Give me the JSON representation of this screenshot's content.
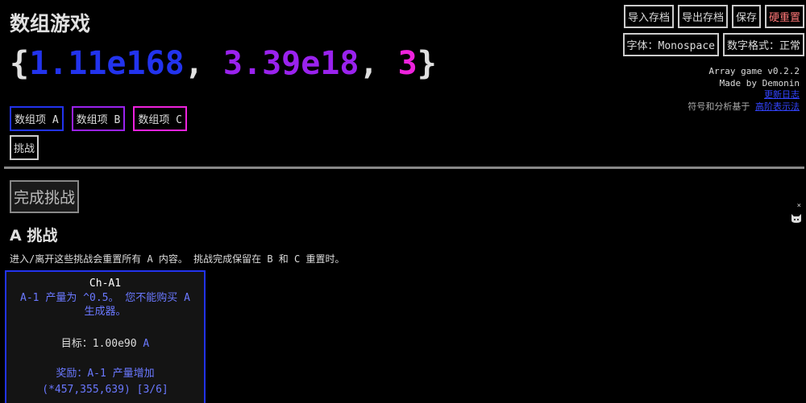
{
  "app": {
    "title": "数组游戏"
  },
  "array": {
    "open": "{",
    "a": "1.11e168",
    "sep1": ", ",
    "b": "3.39e18",
    "sep2": ", ",
    "c": "3",
    "close": "}"
  },
  "tabs": [
    {
      "label": "数组项 A"
    },
    {
      "label": "数组项 B"
    },
    {
      "label": "数组项 C"
    }
  ],
  "challenge_tab": {
    "label": "挑战"
  },
  "header_buttons": {
    "import": "导入存档",
    "export": "导出存档",
    "save": "保存",
    "hard_reset": "硬重置",
    "font": "字体：Monospace",
    "number_format": "数字格式：正常"
  },
  "info": {
    "version": "Array game v0.2.2",
    "author": "Made by Demonin",
    "changelog": "更新日志",
    "notation_prefix": "符号和分析基于",
    "notation_link": "高阶表示法"
  },
  "complete_button": {
    "label": "完成挑战"
  },
  "section": {
    "title": "A 挑战",
    "description": "进入/离开这些挑战会重置所有 A 内容。 挑战完成保留在 B 和 C 重置时。"
  },
  "challenge_card": {
    "name": "Ch-A1",
    "desc_line1": "A-1 产量为 ^0.5。 您不能购买 A",
    "desc_line2": "生成器。",
    "goal_label": "目标：",
    "goal_value": "1.00e90",
    "goal_unit": "A",
    "reward_label": "奖励：A-1 产量增加",
    "reward_value": "(*457,355,639) [3/6]"
  },
  "colors": {
    "a": "#2233ee",
    "b": "#9a22ee",
    "c": "#ee22dd",
    "link": "#3344ff",
    "danger": "#ff7777"
  },
  "icons": {
    "side": "cat-icon",
    "close": "close-icon"
  }
}
